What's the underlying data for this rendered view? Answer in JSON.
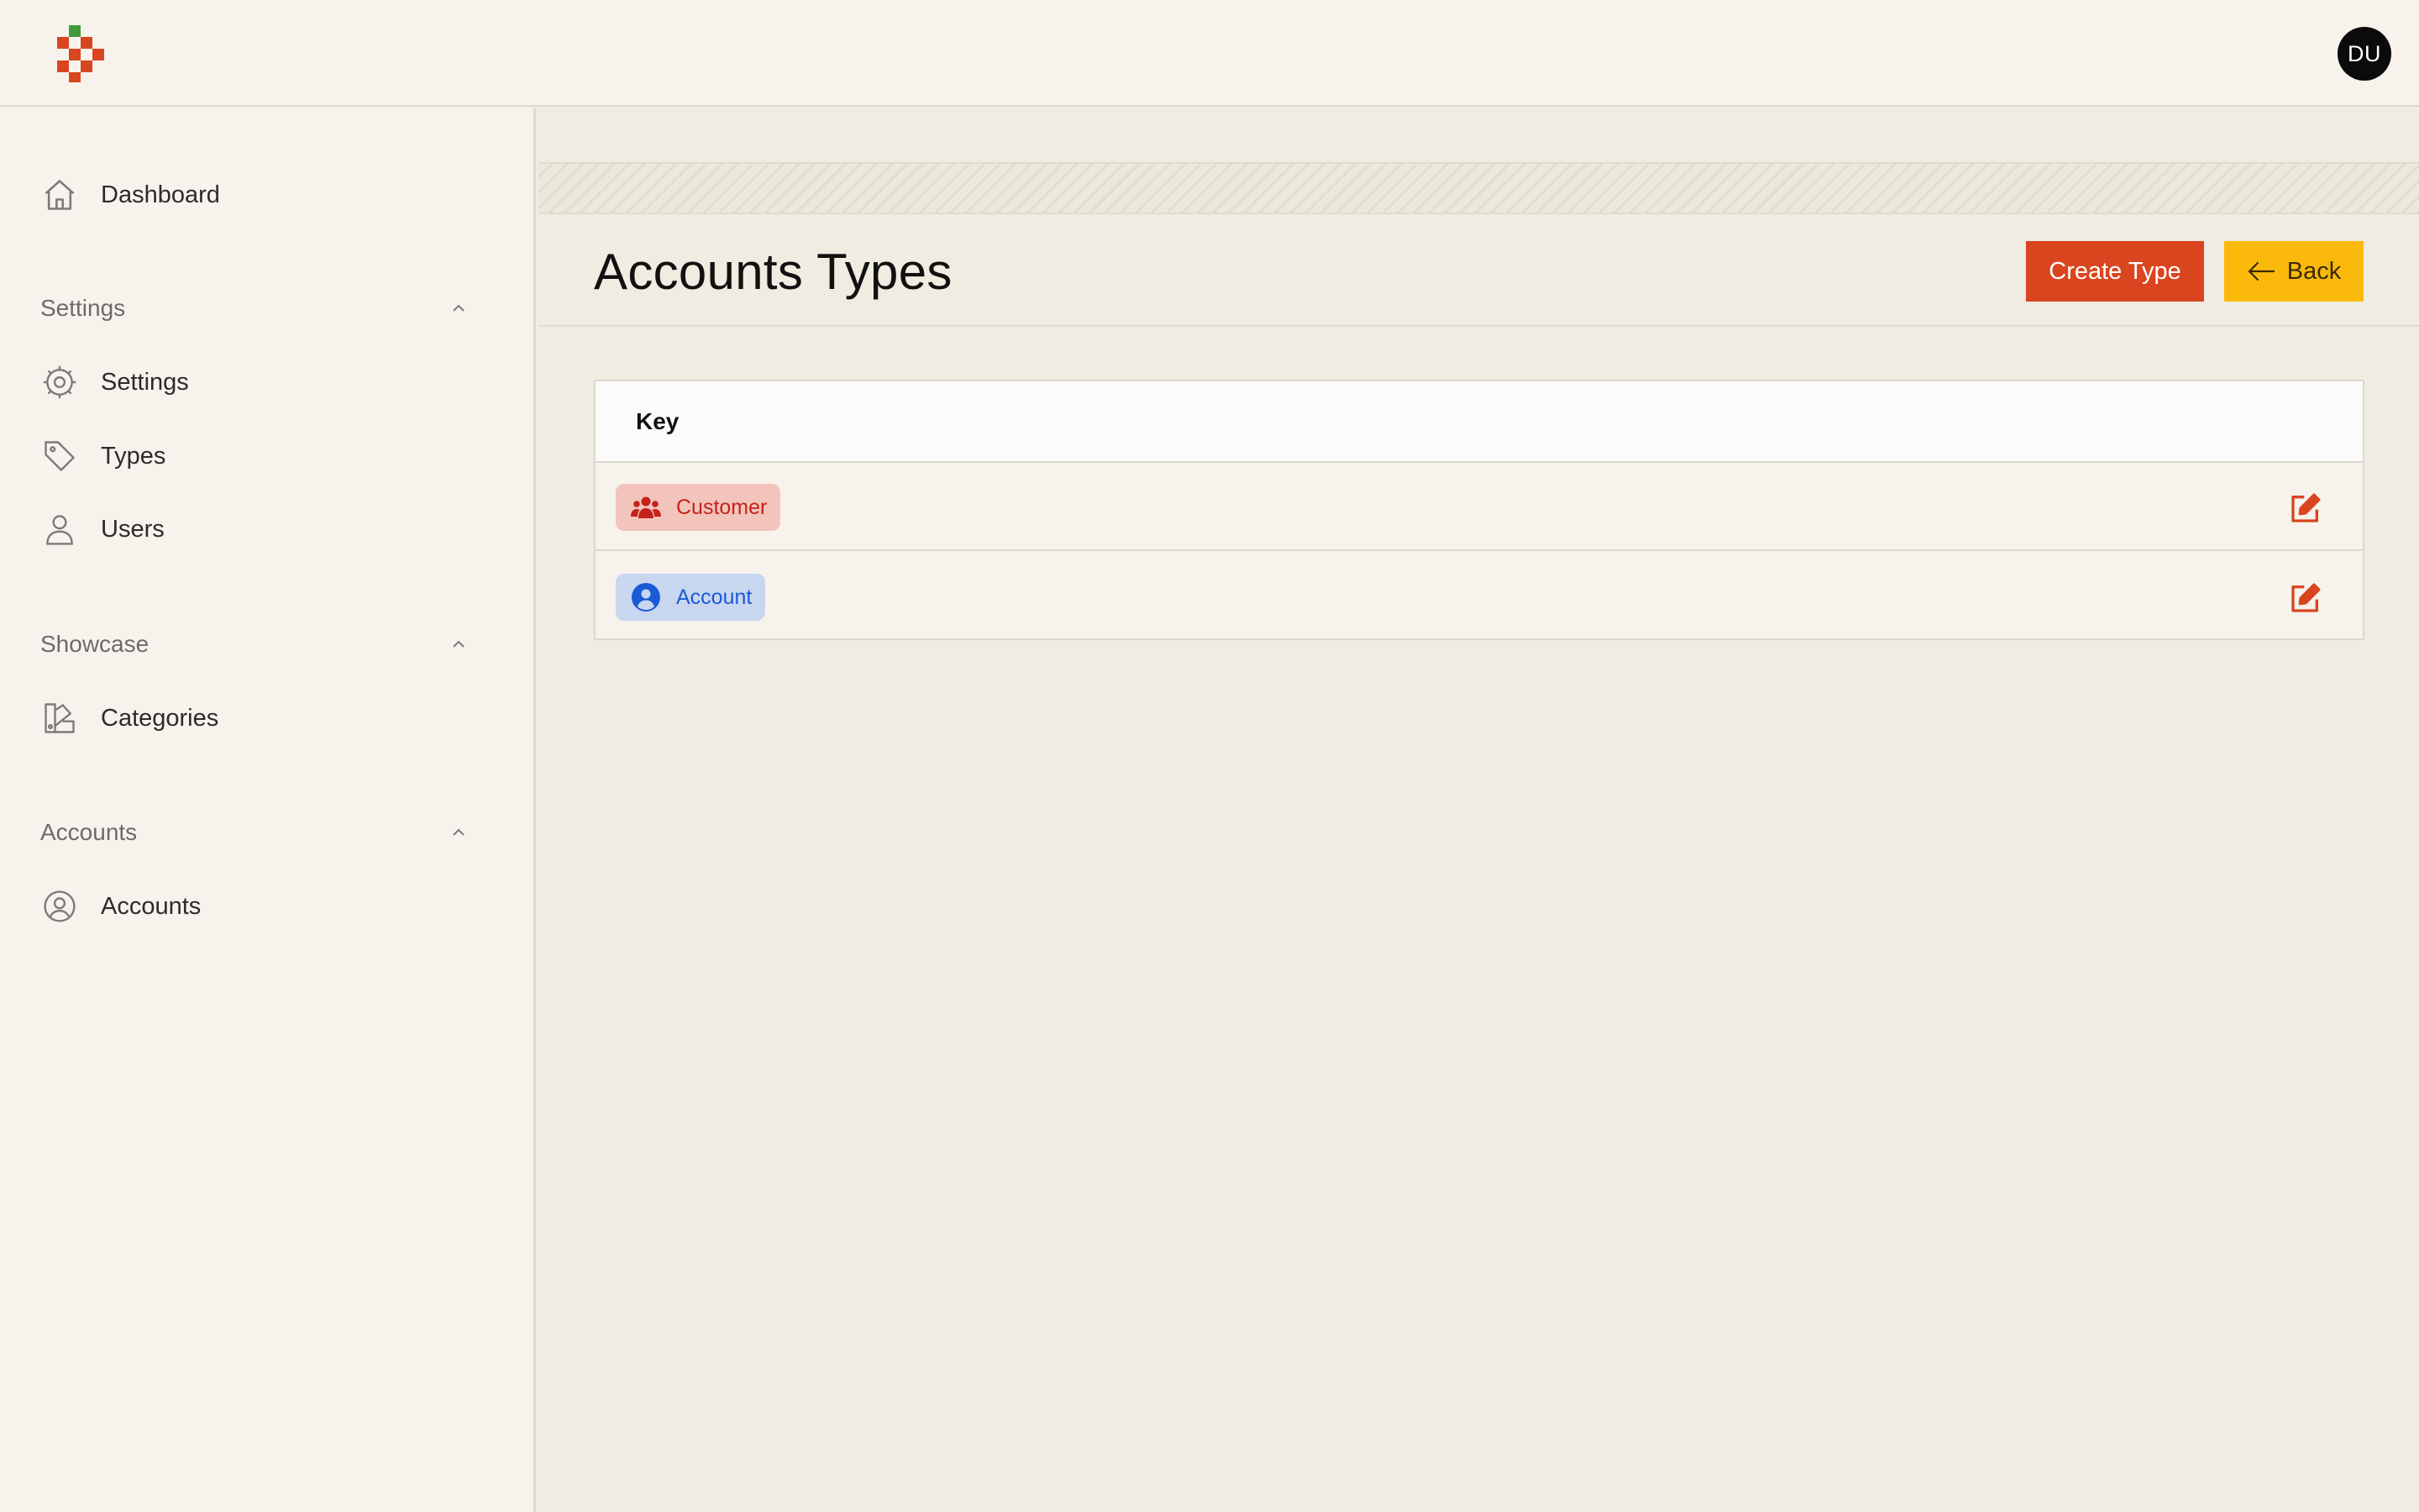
{
  "header": {
    "avatar_initials": "DU"
  },
  "sidebar": {
    "dashboard": {
      "label": "Dashboard",
      "icon": "home-icon"
    },
    "sections": [
      {
        "title": "Settings",
        "items": [
          {
            "label": "Settings",
            "icon": "gear-icon"
          },
          {
            "label": "Types",
            "icon": "tag-icon"
          },
          {
            "label": "Users",
            "icon": "user-icon"
          }
        ]
      },
      {
        "title": "Showcase",
        "items": [
          {
            "label": "Categories",
            "icon": "swatch-icon"
          }
        ]
      },
      {
        "title": "Accounts",
        "items": [
          {
            "label": "Accounts",
            "icon": "user-circle-icon"
          }
        ]
      }
    ]
  },
  "main": {
    "title": "Accounts Types",
    "create_button": "Create Type",
    "back_button": "Back",
    "table": {
      "header": "Key",
      "rows": [
        {
          "label": "Customer",
          "icon": "users-icon",
          "color": "#c4221b",
          "background": "#f2c4bb"
        },
        {
          "label": "Account",
          "icon": "user-circle-filled-icon",
          "color": "#1a5ad6",
          "background": "#c9d6ef"
        }
      ]
    }
  },
  "colors": {
    "accent": "#d9451f",
    "back_button": "#fbba0b"
  }
}
